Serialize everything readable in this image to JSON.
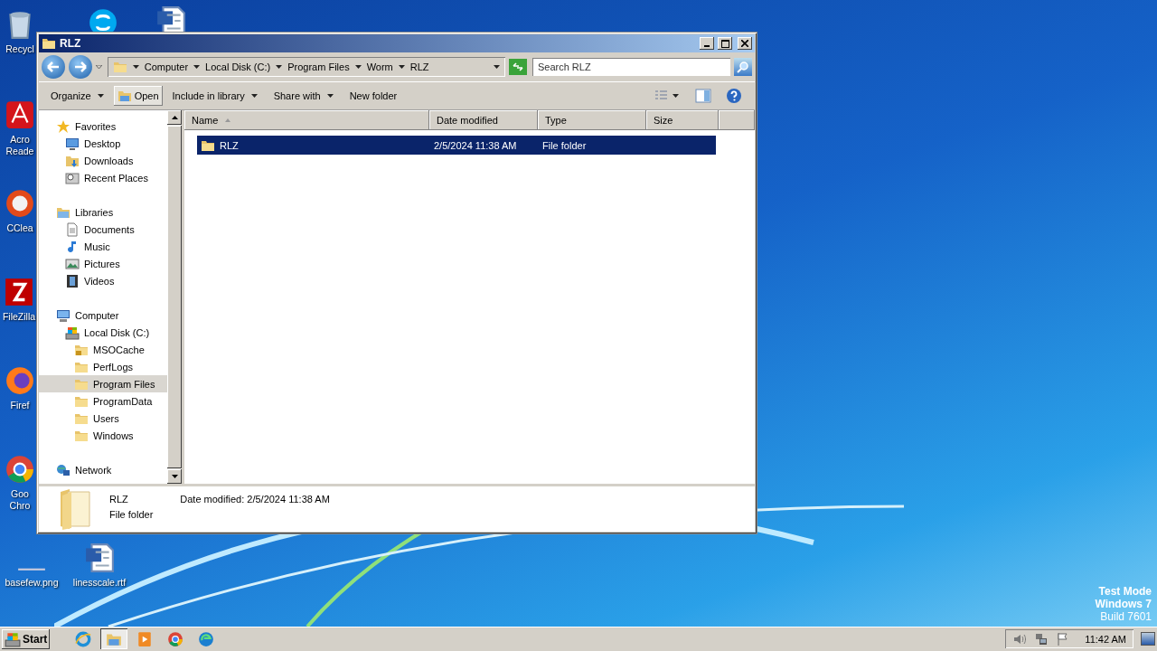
{
  "desktop": {
    "icons": [
      {
        "kind": "recycle",
        "lines": [
          "Recycl"
        ]
      },
      {
        "kind": "skype"
      },
      {
        "kind": "word"
      },
      {
        "kind": "acrobat",
        "lines": [
          "Acro",
          "Reade"
        ]
      },
      {
        "kind": "ccleaner",
        "lines": [
          "CClea"
        ]
      },
      {
        "kind": "filezilla",
        "lines": [
          "FileZilla"
        ]
      },
      {
        "kind": "firefox",
        "lines": [
          "Firef"
        ]
      },
      {
        "kind": "chrome",
        "lines": [
          "Goo",
          "Chro"
        ]
      },
      {
        "kind": "image",
        "lines": [
          "basefew.png"
        ]
      },
      {
        "kind": "word",
        "lines": [
          "linesscale.rtf"
        ]
      }
    ],
    "watermark": [
      "Test Mode",
      "Windows 7",
      "Build 7601"
    ]
  },
  "window": {
    "title": "RLZ",
    "breadcrumb": [
      "Computer",
      "Local Disk (C:)",
      "Program Files",
      "Worm",
      "RLZ"
    ],
    "search": {
      "placeholder": "Search RLZ"
    },
    "toolbar": [
      {
        "label": "Organize",
        "kind": "menu"
      },
      {
        "label": "Open",
        "kind": "pressed"
      },
      {
        "label": "Include in library",
        "kind": "menu"
      },
      {
        "label": "Share with",
        "kind": "menu"
      },
      {
        "label": "New folder",
        "kind": "plain"
      }
    ],
    "nav": [
      {
        "label": "Favorites",
        "kind": "star",
        "selected": false,
        "children": [
          {
            "label": "Desktop",
            "kind": "desktop",
            "selected": false
          },
          {
            "label": "Downloads",
            "kind": "downloads",
            "selected": false
          },
          {
            "label": "Recent Places",
            "kind": "recent",
            "selected": false
          }
        ]
      },
      {
        "label": "Libraries",
        "kind": "library",
        "selected": false,
        "children": [
          {
            "label": "Documents",
            "kind": "documents",
            "selected": false
          },
          {
            "label": "Music",
            "kind": "music",
            "selected": false
          },
          {
            "label": "Pictures",
            "kind": "pictures",
            "selected": false
          },
          {
            "label": "Videos",
            "kind": "videos",
            "selected": false
          }
        ]
      },
      {
        "label": "Computer",
        "kind": "computer",
        "selected": false,
        "children": [
          {
            "label": "Local Disk (C:)",
            "kind": "drive",
            "selected": false,
            "children": [
              {
                "label": "MSOCache",
                "kind": "lockfolder",
                "selected": false
              },
              {
                "label": "PerfLogs",
                "kind": "folder",
                "selected": false
              },
              {
                "label": "Program Files",
                "kind": "folder",
                "selected": true
              },
              {
                "label": "ProgramData",
                "kind": "folder",
                "selected": false
              },
              {
                "label": "Users",
                "kind": "folder",
                "selected": false
              },
              {
                "label": "Windows",
                "kind": "folder",
                "selected": false
              }
            ]
          }
        ]
      },
      {
        "label": "Network",
        "kind": "network",
        "selected": false
      }
    ],
    "columns": [
      {
        "label": "Name",
        "sorted": true
      },
      {
        "label": "Date modified",
        "sorted": false
      },
      {
        "label": "Type",
        "sorted": false
      },
      {
        "label": "Size",
        "sorted": false
      }
    ],
    "rows": [
      {
        "name": "RLZ",
        "date": "2/5/2024 11:38 AM",
        "type": "File folder",
        "selected": true
      }
    ],
    "details": {
      "name": "RLZ",
      "date_label": "Date modified:",
      "date": "2/5/2024 11:38 AM",
      "type": "File folder"
    }
  },
  "taskbar": {
    "start": "Start",
    "apps": [
      {
        "kind": "ie",
        "active": false
      },
      {
        "kind": "explorer",
        "active": true
      },
      {
        "kind": "media",
        "active": false
      },
      {
        "kind": "chrome",
        "active": false
      },
      {
        "kind": "edge",
        "active": false
      }
    ],
    "clock": "11:42 AM"
  }
}
